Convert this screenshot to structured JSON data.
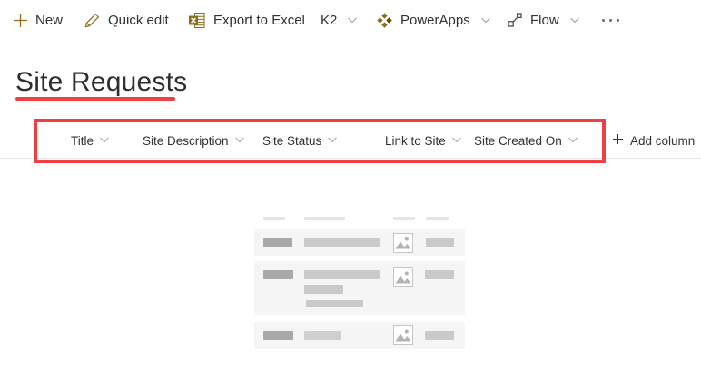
{
  "command_bar": {
    "items": [
      {
        "id": "new",
        "label": "New",
        "icon": "plus-icon",
        "has_dropdown": false
      },
      {
        "id": "quick-edit",
        "label": "Quick edit",
        "icon": "pencil-icon",
        "has_dropdown": false
      },
      {
        "id": "export-excel",
        "label": "Export to Excel",
        "icon": "excel-icon",
        "has_dropdown": false
      },
      {
        "id": "k2",
        "label": "K2",
        "icon": null,
        "has_dropdown": true
      },
      {
        "id": "powerapps",
        "label": "PowerApps",
        "icon": "powerapps-icon",
        "has_dropdown": true
      },
      {
        "id": "flow",
        "label": "Flow",
        "icon": "flow-icon",
        "has_dropdown": true
      }
    ],
    "overflow": {
      "icon": "more-icon"
    }
  },
  "page": {
    "title": "Site Requests"
  },
  "list_header": {
    "columns": [
      {
        "label": "Title",
        "has_dropdown": true
      },
      {
        "label": "Site Description",
        "has_dropdown": true
      },
      {
        "label": "Site Status",
        "has_dropdown": true
      },
      {
        "label": "Link to Site",
        "has_dropdown": true
      },
      {
        "label": "Site Created On",
        "has_dropdown": true
      }
    ],
    "add_column_label": "Add column"
  },
  "empty_state": {
    "description": "loading placeholder graphic with three skeleton rows and image thumbnails"
  },
  "colors": {
    "accent_gold": "#8a6d1f",
    "annotation_red": "#ee4043",
    "text": "#323130",
    "chevron_gray": "#a19f9d",
    "skeleton_row_bg": "#f5f5f5",
    "skeleton_dark": "#a8a8a8",
    "skeleton_medium": "#c9c9c9"
  }
}
